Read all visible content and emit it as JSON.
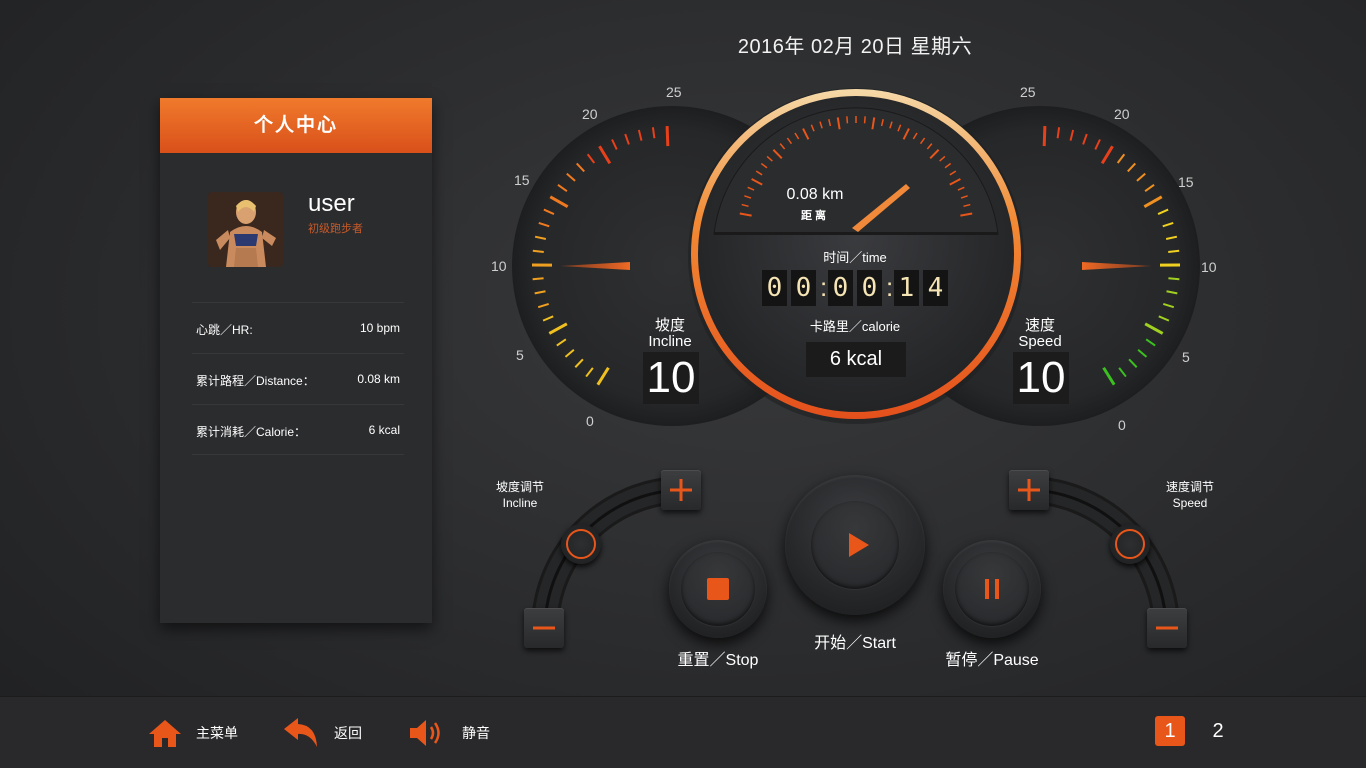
{
  "date": "2016年 02月 20日 星期六",
  "profile": {
    "title": "个人中心",
    "username": "user",
    "level": "初级跑步者",
    "stats": [
      {
        "label": "心跳／HR:",
        "value": "10 bpm"
      },
      {
        "label": "累计路程／Distance：",
        "value": "0.08 km"
      },
      {
        "label": "累计消耗／Calorie：",
        "value": "6 kcal"
      }
    ]
  },
  "incline_gauge": {
    "label_cn": "坡度",
    "label_en": "Incline",
    "value": "10",
    "scale": [
      "0",
      "5",
      "10",
      "15",
      "20",
      "25"
    ],
    "level": 10,
    "max": 25
  },
  "speed_gauge": {
    "label_cn": "速度",
    "label_en": "Speed",
    "value": "10",
    "scale": [
      "0",
      "5",
      "10",
      "15",
      "20",
      "25"
    ],
    "level": 10,
    "max": 25
  },
  "center": {
    "distance_value": "0.08 km",
    "distance_label": "距离",
    "time_label": "时间／time",
    "timer_digits": [
      "0",
      "0",
      "0",
      "0",
      "1",
      "4"
    ],
    "calorie_label": "卡路里／calorie",
    "calorie_value": "6 kcal"
  },
  "controls": {
    "incline_adjust": {
      "cn": "坡度调节",
      "en": "Incline"
    },
    "speed_adjust": {
      "cn": "速度调节",
      "en": "Speed"
    },
    "stop_label": "重置／Stop",
    "start_label": "开始／Start",
    "pause_label": "暂停／Pause"
  },
  "bottom_nav": {
    "home": "主菜单",
    "back": "返回",
    "mute": "静音",
    "pages": [
      "1",
      "2"
    ],
    "active_page": "1"
  },
  "colors": {
    "accent": "#e8561a",
    "accent_light": "#f08a3a",
    "background": "#2d2e30",
    "digit_text": "#f5e4b4"
  }
}
